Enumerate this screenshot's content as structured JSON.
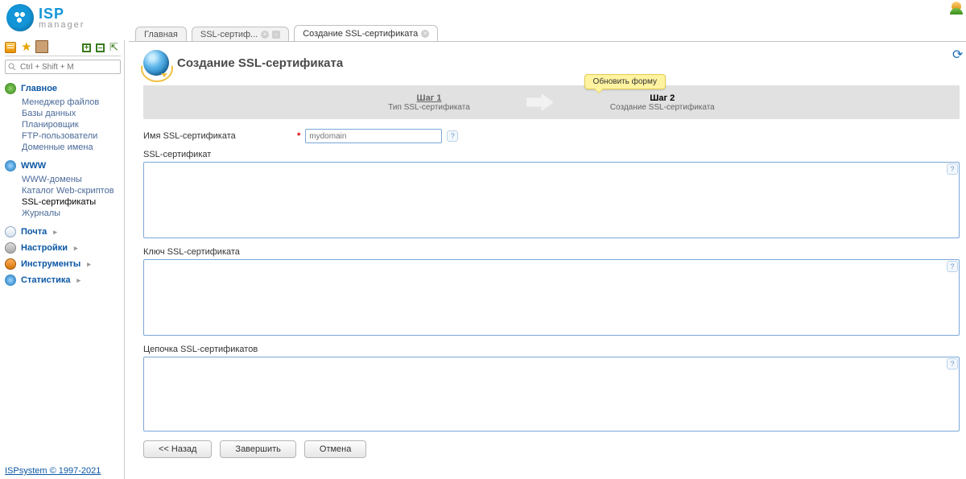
{
  "search_placeholder": "Ctrl + Shift + M",
  "sidebar": {
    "groups": [
      {
        "title": "Главное",
        "items": [
          {
            "label": "Менеджер файлов"
          },
          {
            "label": "Базы данных"
          },
          {
            "label": "Планировщик"
          },
          {
            "label": "FTP-пользователи"
          },
          {
            "label": "Доменные имена"
          }
        ]
      },
      {
        "title": "WWW",
        "items": [
          {
            "label": "WWW-домены"
          },
          {
            "label": "Каталог Web-скриптов"
          },
          {
            "label": "SSL-сертификаты",
            "active": true
          },
          {
            "label": "Журналы"
          }
        ]
      },
      {
        "title": "Почта",
        "collapsed": true
      },
      {
        "title": "Настройки",
        "collapsed": true
      },
      {
        "title": "Инструменты",
        "collapsed": true
      },
      {
        "title": "Статистика",
        "collapsed": true
      }
    ],
    "copyright": "ISPsystem © 1997-2021"
  },
  "tabs": [
    {
      "label": "Главная"
    },
    {
      "label": "SSL-сертиф..."
    },
    {
      "label": "Создание SSL-сертификата",
      "active": true
    }
  ],
  "page_title": "Создание SSL-сертификата",
  "tooltip": "Обновить форму",
  "steps": {
    "s1_n": "Шаг 1",
    "s1_d": "Тип SSL-сертификата",
    "s2_n": "Шаг 2",
    "s2_d": "Создание SSL-сертификата"
  },
  "form": {
    "name_label": "Имя SSL-сертификата",
    "name_placeholder": "mydomain",
    "cert_label": "SSL-сертификат",
    "key_label": "Ключ SSL-сертификата",
    "chain_label": "Цепочка SSL-сертификатов",
    "name_value": "",
    "cert_value": "",
    "key_value": "",
    "chain_value": ""
  },
  "buttons": {
    "back": "<< Назад",
    "finish": "Завершить",
    "cancel": "Отмена"
  }
}
